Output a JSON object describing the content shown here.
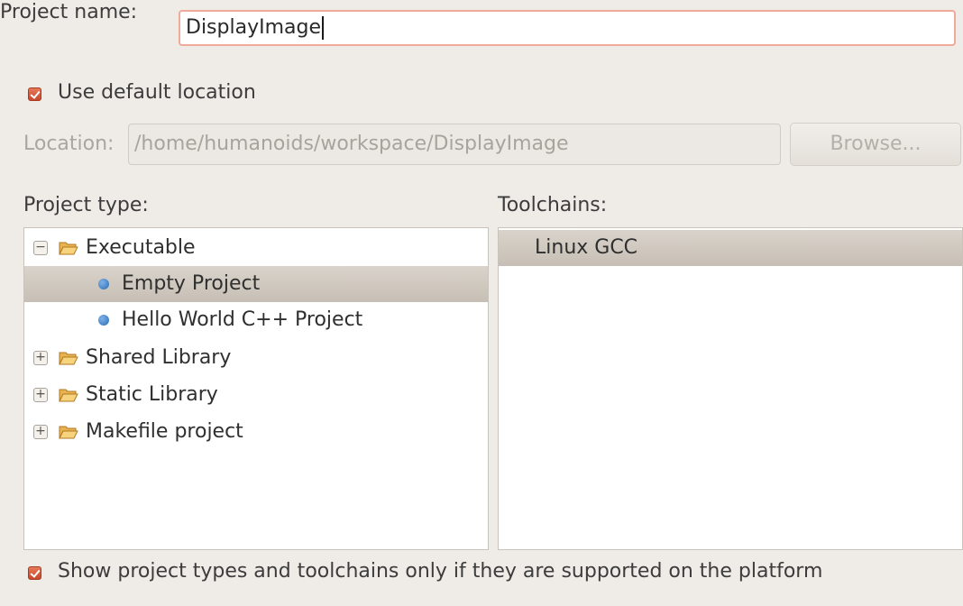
{
  "project_name": {
    "label": "Project name:",
    "value": "DisplayImage"
  },
  "use_default_location": {
    "label": "Use default location",
    "checked": true
  },
  "location": {
    "label": "Location:",
    "value": "/home/humanoids/workspace/DisplayImage",
    "enabled": false
  },
  "browse_button": {
    "label": "Browse...",
    "enabled": false
  },
  "project_type": {
    "label": "Project type:",
    "items": [
      {
        "label": "Executable",
        "kind": "folder",
        "expanded": true
      },
      {
        "label": "Empty Project",
        "kind": "leaf",
        "selected": true
      },
      {
        "label": "Hello World C++ Project",
        "kind": "leaf"
      },
      {
        "label": "Shared Library",
        "kind": "folder",
        "expanded": false
      },
      {
        "label": "Static Library",
        "kind": "folder",
        "expanded": false
      },
      {
        "label": "Makefile project",
        "kind": "folder",
        "expanded": false
      }
    ]
  },
  "toolchains": {
    "label": "Toolchains:",
    "items": [
      {
        "label": "Linux GCC",
        "selected": true
      }
    ]
  },
  "show_supported_only": {
    "label": "Show project types and toolchains only if they are supported on the platform",
    "checked": true
  },
  "icons": {
    "folder": "folder-open-icon",
    "leaf": "project-template-icon",
    "expanded": "collapse-minus-icon",
    "collapsed": "expand-plus-icon"
  },
  "colors": {
    "background": "#efebe7",
    "checkbox_accent": "#d8583a",
    "selection": "#cdc6bd",
    "focus_border": "#f0a99a"
  }
}
